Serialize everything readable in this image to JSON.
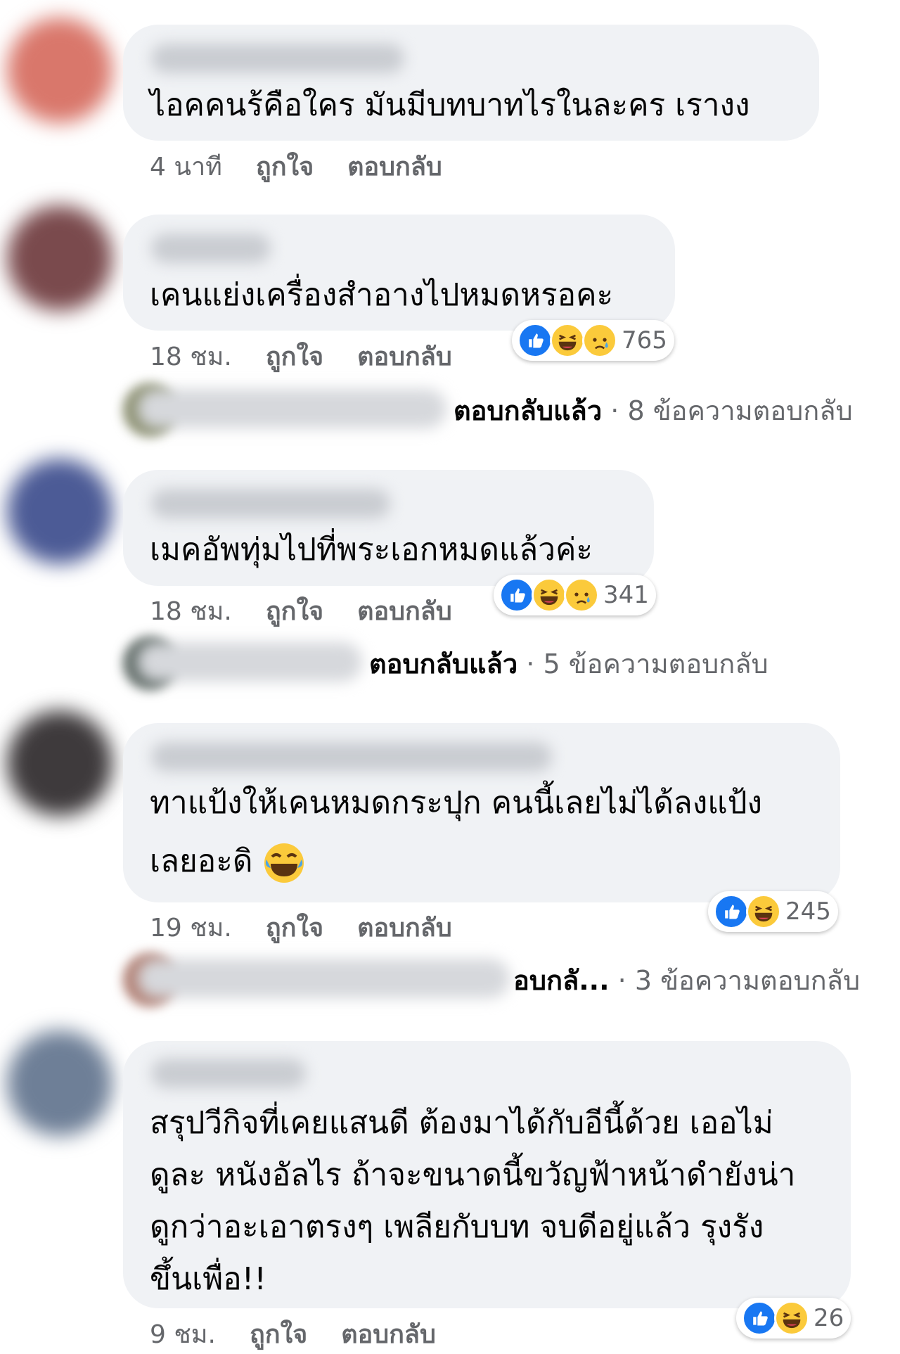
{
  "comments": [
    {
      "text_lines": [
        "ไอคคนร้คือใคร มันมีบทบาทไรในละคร เรางง"
      ],
      "time": "4 นาที",
      "like_label": "ถูกใจ",
      "reply_label": "ตอบกลับ",
      "avatar_color": "#d9776b"
    },
    {
      "text_lines": [
        "เคนแย่งเครื่องสำอางไปหมดหรอคะ"
      ],
      "time": "18 ชม.",
      "like_label": "ถูกใจ",
      "reply_label": "ตอบกลับ",
      "reaction_count": "765",
      "reply_summary": {
        "replied": "ตอบกลับแล้ว",
        "dot": "·",
        "count": "8 ข้อความตอบกลับ"
      },
      "avatar_color": "#7a4a4d"
    },
    {
      "text_lines": [
        "เมคอัพทุ่มไปที่พระเอกหมดแล้วค่ะ"
      ],
      "time": "18 ชม.",
      "like_label": "ถูกใจ",
      "reply_label": "ตอบกลับ",
      "reaction_count": "341",
      "reply_summary": {
        "replied": "ตอบกลับแล้ว",
        "dot": "·",
        "count": "5 ข้อความตอบกลับ"
      },
      "avatar_color": "#4c5b96"
    },
    {
      "text_lines": [
        "ทาแป้งให้เคนหมดกระปุก คนนี้เลยไม่ได้ลงแป้ง",
        "เลยอะดิ"
      ],
      "time": "19 ชม.",
      "like_label": "ถูกใจ",
      "reply_label": "ตอบกลับ",
      "reaction_count": "245",
      "reply_summary": {
        "replied": "อบกลั...",
        "dot": "·",
        "count": "3 ข้อความตอบกลับ"
      },
      "avatar_color": "#3e3a3c"
    },
    {
      "text_lines": [
        "สรุปวีกิจที่เคยแสนดี ต้องมาได้กับอีนี้ด้วย เออไม่",
        "ดูละ หนังอัลไร ถ้าจะขนาดนี้ขวัญฟ้าหน้าดำยังน่า",
        "ดูกว่าอะเอาตรงๆ เพลียกับบท จบดีอยู่แล้ว รุงรัง",
        "ขึ้นเพื่อ!!"
      ],
      "time": "9 ชม.",
      "like_label": "ถูกใจ",
      "reply_label": "ตอบกลับ",
      "reaction_count": "26",
      "avatar_color": "#6e7f97"
    }
  ],
  "reaction_icons": [
    "like-icon",
    "haha-icon",
    "sad-icon"
  ],
  "colors": {
    "bubble": "#f0f2f5",
    "like": "#1877f2",
    "emoji": "#fbca3b",
    "meta": "#65676b"
  }
}
